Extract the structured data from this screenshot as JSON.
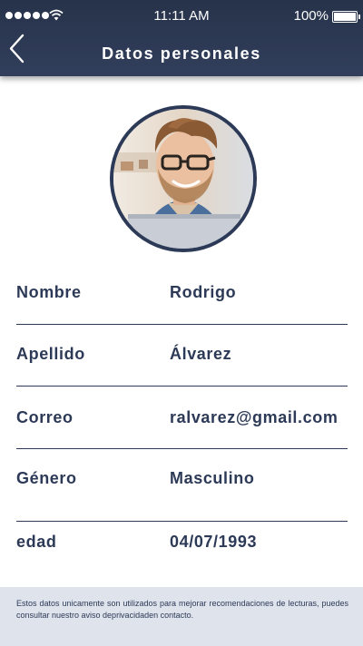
{
  "status_bar": {
    "time": "11:11 AM",
    "battery": "100%"
  },
  "header": {
    "title": "Datos personales",
    "back_icon": "chevron-left-icon"
  },
  "profile": {
    "fields": [
      {
        "label": "Nombre",
        "value": "Rodrigo"
      },
      {
        "label": "Apellido",
        "value": "Álvarez"
      },
      {
        "label": "Correo",
        "value": "ralvarez@gmail.com"
      },
      {
        "label": "Género",
        "value": "Masculino"
      },
      {
        "label": "edad",
        "value": "04/07/1993"
      }
    ]
  },
  "footer": {
    "text": "Estos datos unicamente son utilizados para mejorar recomendaciones de lecturas, puedes consultar nuestro aviso deprivacidaden contacto."
  },
  "colors": {
    "header_bg": "#2c3a57",
    "text": "#2c3a57",
    "footer_bg": "#dfe3ec"
  }
}
